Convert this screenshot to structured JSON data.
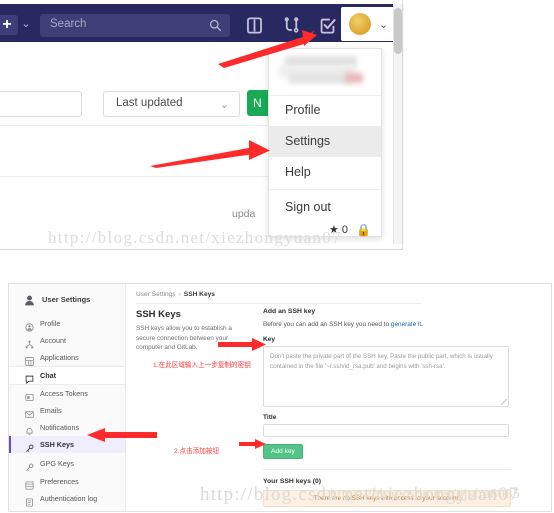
{
  "top_panel": {
    "navbar": {
      "plus_label": "+",
      "caret": "⌄",
      "search_placeholder": "Search",
      "icons": [
        "issues-icon",
        "merge-request-icon",
        "todos-icon"
      ],
      "avatar": "user-avatar",
      "avatar_caret": "⌄"
    },
    "toolbar": {
      "sort_label": "Last updated",
      "sort_caret": "⌄",
      "new_button": "N",
      "updated_text": "upda"
    },
    "dropdown": {
      "items": [
        "Profile",
        "Settings",
        "Help",
        "Sign out"
      ],
      "active": "Settings"
    },
    "meta": {
      "star_glyph": "★",
      "star_count": "0",
      "lock_glyph": "🔒"
    },
    "watermark": "http://blog.csdn.net/xiezhongyuan07"
  },
  "bottom_panel": {
    "sidebar": {
      "header": "User Settings",
      "items": [
        {
          "label": "Profile",
          "icon": "profile-icon"
        },
        {
          "label": "Account",
          "icon": "account-icon"
        },
        {
          "label": "Applications",
          "icon": "applications-icon"
        },
        {
          "label": "Chat",
          "icon": "chat-icon"
        },
        {
          "label": "Access Tokens",
          "icon": "access-tokens-icon"
        },
        {
          "label": "Emails",
          "icon": "emails-icon"
        },
        {
          "label": "Notifications",
          "icon": "notifications-icon"
        },
        {
          "label": "SSH Keys",
          "icon": "key-icon"
        },
        {
          "label": "GPG Keys",
          "icon": "key-icon"
        },
        {
          "label": "Preferences",
          "icon": "preferences-icon"
        },
        {
          "label": "Authentication log",
          "icon": "auth-log-icon"
        }
      ],
      "active": "SSH Keys"
    },
    "breadcrumb": {
      "root": "User Settings",
      "separator": "›",
      "current": "SSH Keys"
    },
    "section": {
      "title": "SSH Keys",
      "description": "SSH keys allow you to establish a secure connection between your computer and GitLab."
    },
    "form": {
      "heading": "Add an SSH key",
      "intro_prefix": "Before you can add an SSH key you need to ",
      "intro_link": "generate it",
      "intro_suffix": ".",
      "key_label": "Key",
      "key_placeholder": "Don't paste the private part of the SSH key. Paste the public part, which is usually contained in the file '~/.ssh/id_rsa.pub' and begins with 'ssh-rsa'.",
      "key_value": "",
      "title_label": "Title",
      "title_value": "",
      "submit_label": "Add key"
    },
    "keys_list": {
      "heading": "Your SSH keys (0)",
      "empty_message": "There are no SSH keys with access to your account."
    },
    "annotations": [
      "1.在此区域输入上一步复制的密钥",
      "2.点击添加按钮"
    ],
    "watermark": "http://blog.csdn.net/xiezhongyuan07",
    "watermark_overlay": "https://blog.csdn.net/gjsfra8085"
  },
  "colors": {
    "navbar": "#292961",
    "accent_green": "#1aaa55",
    "arrow_red": "#ff2a2a",
    "sidebar_active": "#6b4fbb",
    "link_blue": "#1b69b6"
  }
}
